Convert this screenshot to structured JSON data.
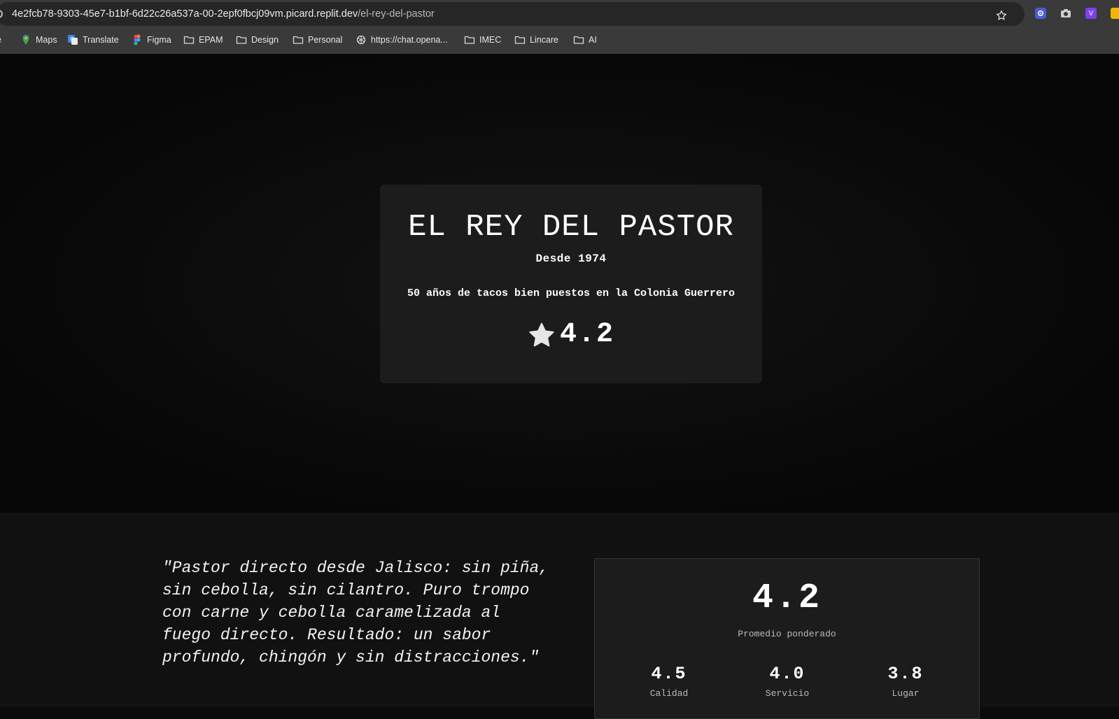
{
  "browser": {
    "url_host": "4e2fcb78-9303-45e7-b1bf-6d22c26a537a-00-2epf0fbcj09vm.picard.replit.dev",
    "url_path": "/el-rey-del-pastor",
    "bookmarks": [
      {
        "label": "pe",
        "icon": "folder-icon"
      },
      {
        "label": "Maps",
        "icon": "maps-icon"
      },
      {
        "label": "Translate",
        "icon": "translate-icon"
      },
      {
        "label": "Figma",
        "icon": "figma-icon"
      },
      {
        "label": "EPAM",
        "icon": "folder-icon"
      },
      {
        "label": "Design",
        "icon": "folder-icon"
      },
      {
        "label": "Personal",
        "icon": "folder-icon"
      },
      {
        "label": "https://chat.opena...",
        "icon": "openai-icon"
      },
      {
        "label": "IMEC",
        "icon": "folder-icon"
      },
      {
        "label": "Lincare",
        "icon": "folder-icon"
      },
      {
        "label": "AI",
        "icon": "folder-icon"
      }
    ],
    "extensions": [
      "gear-extension-icon",
      "camera-extension-icon",
      "v-extension-icon",
      "yellow-extension-icon"
    ],
    "extension_v_label": "V"
  },
  "hero": {
    "title": "EL REY DEL PASTOR",
    "since": "Desde 1974",
    "tagline": "50 años de tacos bien puestos en la Colonia Guerrero",
    "rating": "4.2"
  },
  "review": {
    "quote": "\"Pastor directo desde Jalisco: sin piña, sin cebolla, sin cilantro. Puro trompo con carne y cebolla caramelizada al fuego directo. Resultado: un sabor profundo, chingón y sin distracciones.\"",
    "score": "4.2",
    "score_label": "Promedio ponderado",
    "subscores": [
      {
        "value": "4.5",
        "label": "Calidad"
      },
      {
        "value": "4.0",
        "label": "Servicio"
      },
      {
        "value": "3.8",
        "label": "Lugar"
      }
    ]
  }
}
